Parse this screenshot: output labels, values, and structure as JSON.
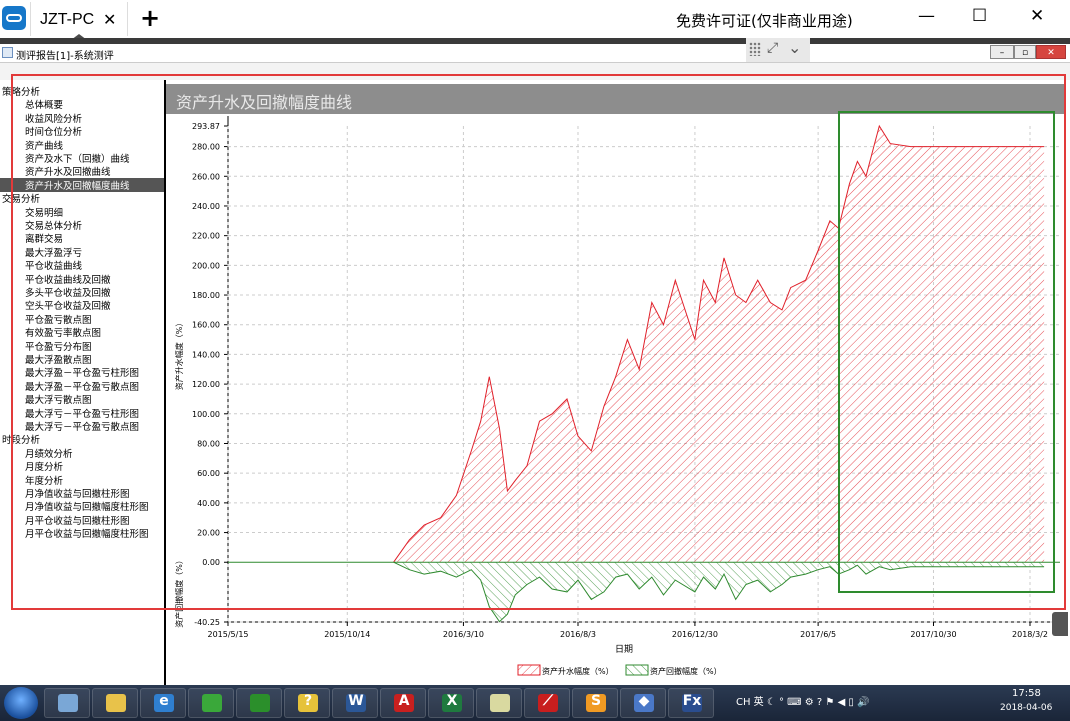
{
  "teamviewer": {
    "tab_title": "JZT-PC",
    "tab_close": "✕",
    "new_tab": "+",
    "license": "免费许可证(仅非商业用途)",
    "minimize": "—",
    "maximize": "☐",
    "close": "✕"
  },
  "app": {
    "title": "测评报告[1]-系统测评",
    "ctl_min": "–",
    "ctl_max": "▫",
    "ctl_close": "✕"
  },
  "sidebar": {
    "items": [
      {
        "label": "策略分析",
        "kind": "cat"
      },
      {
        "label": "总体概要",
        "kind": "item"
      },
      {
        "label": "收益风险分析",
        "kind": "item"
      },
      {
        "label": "时间仓位分析",
        "kind": "item"
      },
      {
        "label": "资产曲线",
        "kind": "item"
      },
      {
        "label": "资产及水下（回撤）曲线",
        "kind": "item"
      },
      {
        "label": "资产升水及回撤曲线",
        "kind": "item"
      },
      {
        "label": "资产升水及回撤幅度曲线",
        "kind": "sel"
      },
      {
        "label": "交易分析",
        "kind": "cat"
      },
      {
        "label": "交易明细",
        "kind": "item"
      },
      {
        "label": "交易总体分析",
        "kind": "item"
      },
      {
        "label": "离群交易",
        "kind": "item"
      },
      {
        "label": "最大浮盈浮亏",
        "kind": "item"
      },
      {
        "label": "平仓收益曲线",
        "kind": "item"
      },
      {
        "label": "平仓收益曲线及回撤",
        "kind": "item"
      },
      {
        "label": "多头平仓收益及回撤",
        "kind": "item"
      },
      {
        "label": "空头平仓收益及回撤",
        "kind": "item"
      },
      {
        "label": "平仓盈亏散点图",
        "kind": "item"
      },
      {
        "label": "有效盈亏率散点图",
        "kind": "item"
      },
      {
        "label": "平仓盈亏分布图",
        "kind": "item"
      },
      {
        "label": "最大浮盈散点图",
        "kind": "item"
      },
      {
        "label": "最大浮盈－平仓盈亏柱形图",
        "kind": "item"
      },
      {
        "label": "最大浮盈－平仓盈亏散点图",
        "kind": "item"
      },
      {
        "label": "最大浮亏散点图",
        "kind": "item"
      },
      {
        "label": "最大浮亏－平仓盈亏柱形图",
        "kind": "item"
      },
      {
        "label": "最大浮亏－平仓盈亏散点图",
        "kind": "item"
      },
      {
        "label": "时段分析",
        "kind": "cat"
      },
      {
        "label": "月绩效分析",
        "kind": "item"
      },
      {
        "label": "月度分析",
        "kind": "item"
      },
      {
        "label": "年度分析",
        "kind": "item"
      },
      {
        "label": "月净值收益与回撤柱形图",
        "kind": "item"
      },
      {
        "label": "月净值收益与回撤幅度柱形图",
        "kind": "item"
      },
      {
        "label": "月平仓收益与回撤柱形图",
        "kind": "item"
      },
      {
        "label": "月平仓收益与回撤幅度柱形图",
        "kind": "item"
      }
    ]
  },
  "panel": {
    "heading": "资产升水及回撤幅度曲线"
  },
  "chart_data": {
    "type": "area",
    "xlabel": "日期",
    "ylabel_top": "资产升水幅度（%）",
    "ylabel_bottom": "资产回撤幅度（%）",
    "x_ticks": [
      "2015/5/15",
      "2015/10/14",
      "2016/3/10",
      "2016/8/3",
      "2016/12/30",
      "2017/6/5",
      "2017/10/30",
      "2018/3/2"
    ],
    "y_ticks": [
      "293.87",
      "280.00",
      "260.00",
      "240.00",
      "220.00",
      "200.00",
      "180.00",
      "160.00",
      "140.00",
      "120.00",
      "100.00",
      "80.00",
      "60.00",
      "40.00",
      "20.00",
      "0.00",
      "-40.25"
    ],
    "ylim": [
      -40.25,
      293.87
    ],
    "legend": [
      "资产升水幅度（%）",
      "资产回撤幅度（%）"
    ],
    "legend_placement": "bottom",
    "grid": true,
    "colors": {
      "upper": "#e0202a",
      "lower": "#2f8a2f"
    },
    "series": [
      {
        "name": "资产升水幅度（%）",
        "x": [
          "2015/12/12",
          "2016/1/1",
          "2016/1/20",
          "2016/2/10",
          "2016/3/1",
          "2016/3/20",
          "2016/4/1",
          "2016/4/12",
          "2016/4/25",
          "2016/5/5",
          "2016/5/15",
          "2016/5/30",
          "2016/6/15",
          "2016/7/1",
          "2016/7/20",
          "2016/8/3",
          "2016/8/20",
          "2016/9/5",
          "2016/9/20",
          "2016/10/5",
          "2016/10/20",
          "2016/11/5",
          "2016/11/20",
          "2016/12/5",
          "2016/12/30",
          "2017/1/10",
          "2017/1/25",
          "2017/2/5",
          "2017/2/20",
          "2017/3/5",
          "2017/3/20",
          "2017/4/5",
          "2017/4/20",
          "2017/5/1",
          "2017/5/20",
          "2017/6/5",
          "2017/6/20",
          "2017/7/1",
          "2017/7/15",
          "2017/7/25",
          "2017/8/5",
          "2017/8/15",
          "2017/8/22",
          "2017/9/5",
          "2017/10/1",
          "2017/11/1",
          "2018/1/1",
          "2018/3/20"
        ],
        "values": [
          0,
          15,
          25,
          30,
          45,
          75,
          95,
          125,
          90,
          48,
          55,
          65,
          95,
          100,
          110,
          85,
          75,
          105,
          125,
          150,
          130,
          175,
          160,
          190,
          150,
          190,
          175,
          205,
          180,
          175,
          190,
          175,
          170,
          185,
          190,
          210,
          230,
          225,
          255,
          270,
          260,
          280,
          293.87,
          282,
          280,
          280,
          280,
          280
        ]
      },
      {
        "name": "资产回撤幅度（%）",
        "x": [
          "2015/12/12",
          "2016/1/1",
          "2016/1/20",
          "2016/2/10",
          "2016/3/1",
          "2016/3/20",
          "2016/4/1",
          "2016/4/12",
          "2016/4/25",
          "2016/5/5",
          "2016/5/15",
          "2016/5/30",
          "2016/6/15",
          "2016/7/1",
          "2016/7/20",
          "2016/8/3",
          "2016/8/20",
          "2016/9/5",
          "2016/9/20",
          "2016/10/5",
          "2016/10/20",
          "2016/11/5",
          "2016/11/20",
          "2016/12/5",
          "2016/12/30",
          "2017/1/10",
          "2017/1/25",
          "2017/2/5",
          "2017/2/20",
          "2017/3/5",
          "2017/3/20",
          "2017/4/5",
          "2017/4/20",
          "2017/5/1",
          "2017/5/20",
          "2017/6/5",
          "2017/6/20",
          "2017/7/1",
          "2017/7/15",
          "2017/7/25",
          "2017/8/5",
          "2017/8/15",
          "2017/8/22",
          "2017/9/5",
          "2017/10/1",
          "2017/11/1",
          "2018/1/1",
          "2018/3/20"
        ],
        "values": [
          0,
          -5,
          -8,
          -6,
          -10,
          -5,
          -12,
          -30,
          -40,
          -35,
          -22,
          -15,
          -10,
          -18,
          -20,
          -12,
          -25,
          -20,
          -10,
          -8,
          -18,
          -10,
          -22,
          -12,
          -20,
          -10,
          -18,
          -8,
          -25,
          -15,
          -12,
          -20,
          -15,
          -10,
          -8,
          -5,
          -3,
          -8,
          -5,
          -2,
          -8,
          -5,
          -3,
          -5,
          -3,
          -3,
          -3,
          -3
        ]
      }
    ]
  },
  "taskbar": {
    "apps": [
      {
        "icon": "calculator-icon",
        "color": "#7aa7d6",
        "glyph": ""
      },
      {
        "icon": "explorer-icon",
        "color": "#e8c24a",
        "glyph": ""
      },
      {
        "icon": "ie-icon",
        "color": "#2f7fd0",
        "glyph": "e"
      },
      {
        "icon": "green-app-icon",
        "color": "#3aa83a",
        "glyph": ""
      },
      {
        "icon": "frog-app-icon",
        "color": "#2b8f2b",
        "glyph": ""
      },
      {
        "icon": "help-icon",
        "color": "#e6c23a",
        "glyph": "?"
      },
      {
        "icon": "word-icon",
        "color": "#2b5797",
        "glyph": "W"
      },
      {
        "icon": "pdf-icon",
        "color": "#c8201f",
        "glyph": "A"
      },
      {
        "icon": "excel-icon",
        "color": "#1f7a3f",
        "glyph": "X"
      },
      {
        "icon": "notepad-icon",
        "color": "#d9d9a0",
        "glyph": ""
      },
      {
        "icon": "red-app-icon",
        "color": "#c81e1e",
        "glyph": "⟋"
      },
      {
        "icon": "sublime-icon",
        "color": "#f09a23",
        "glyph": "S"
      },
      {
        "icon": "diamond-app-icon",
        "color": "#4a78c8",
        "glyph": "◆"
      },
      {
        "icon": "fx-icon",
        "color": "#2a4d8f",
        "glyph": "Fx"
      }
    ],
    "tray": "CH 英 ☾ ° ⌨ ⚙ ? ⚑ ◀ ▯ 🔊",
    "time": "17:58",
    "date": "2018-04-06"
  }
}
